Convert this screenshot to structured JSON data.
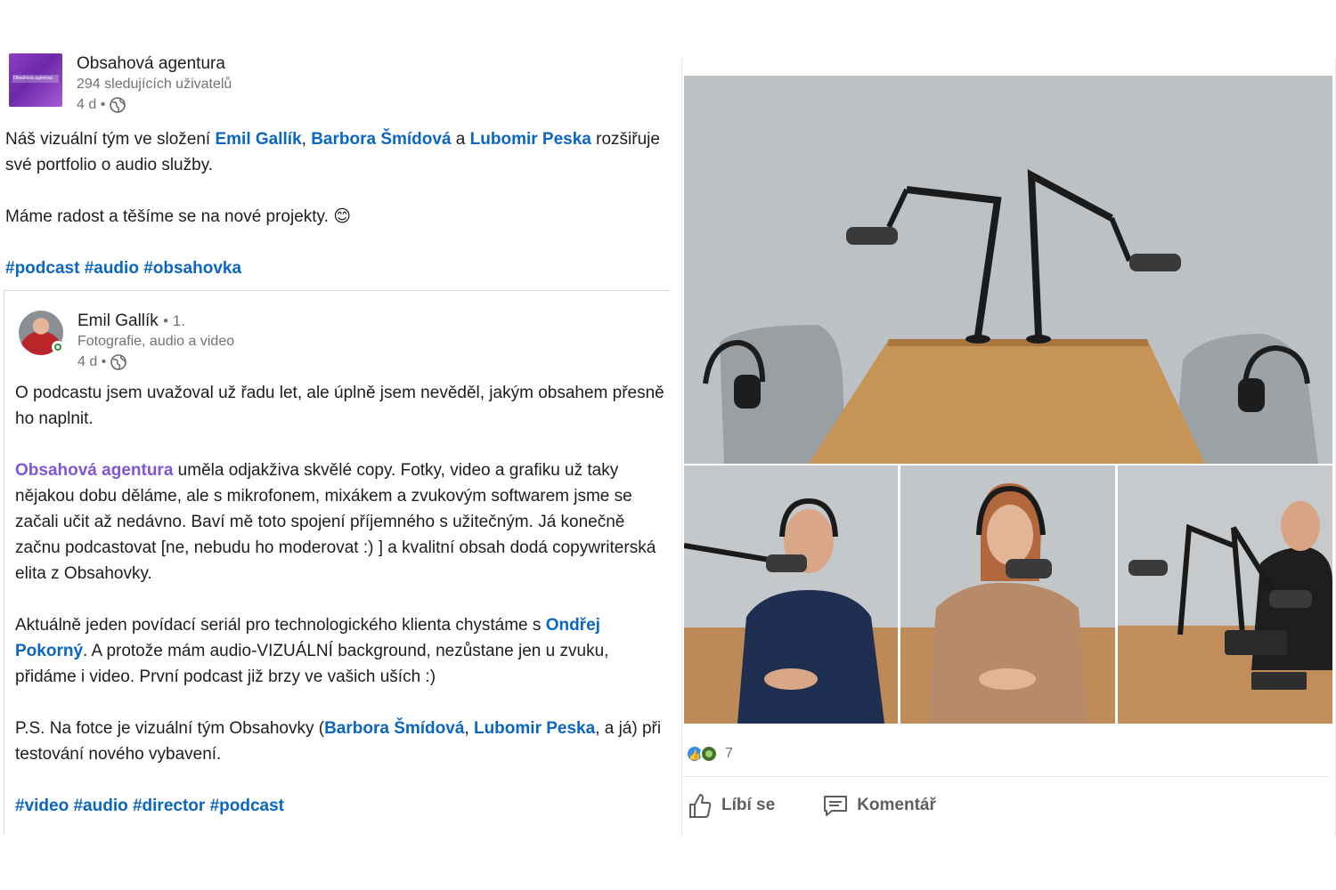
{
  "org_post": {
    "author": "Obsahová agentura",
    "logo_text": "Obsahová agentura",
    "followers": "294 sledujících uživatelů",
    "time": "4 d •",
    "text": {
      "p1_a": "Náš vizuální tým ve složení ",
      "mention1": "Emil Gallík",
      "p1_b": ", ",
      "mention2": "Barbora Šmídová",
      "p1_c": " a ",
      "mention3": "Lubomir Peska",
      "p1_d": " rozšiřuje své portfolio o audio služby.",
      "p2": "Máme radost a těšíme se na nové projekty. 😊",
      "hashtags": "#podcast #audio #obsahovka"
    }
  },
  "shared_post": {
    "author": "Emil Gallík",
    "degree": "• 1.",
    "headline": "Fotografie, audio a video",
    "time": "4 d •",
    "p1": "O podcastu jsem uvažoval už řadu let, ale úplně jsem nevěděl, jakým obsahem přesně ho naplnit.",
    "p2_mention": "Obsahová agentura",
    "p2_rest": " uměla odjakživa skvělé copy.  Fotky, video a grafiku už taky nějakou dobu děláme, ale s mikrofonem, mixákem a zvukovým softwarem jsme se začali učit až nedávno. Baví mě toto spojení příjemného s užitečným. Já konečně začnu podcastovat [ne, nebudu ho moderovat :) ] a kvalitní obsah dodá copywriterská elita z Obsahovky.",
    "p3_a": "Aktuálně jeden povídací seriál pro technologického klienta chystáme s ",
    "p3_mention": "Ondřej Pokorný",
    "p3_b": ". A protože mám audio-VIZUÁLNÍ background, nezůstane jen u zvuku, přidáme i video. První podcast již brzy ve vašich uších :)",
    "p4_a": "P.S. Na fotce je vizuální tým Obsahovky (",
    "p4_mention1": "Barbora Šmídová",
    "p4_sep": ", ",
    "p4_mention2": "Lubomir Peska",
    "p4_b": ", a já) při testování nového vybavení.",
    "hashtags": "#video #audio #director #podcast"
  },
  "engagement": {
    "reaction_count": "7",
    "like_label": "Líbí se",
    "comment_label": "Komentář"
  },
  "colors": {
    "link": "#0a66c2",
    "company_link": "#7f55d9",
    "muted": "#727272"
  }
}
